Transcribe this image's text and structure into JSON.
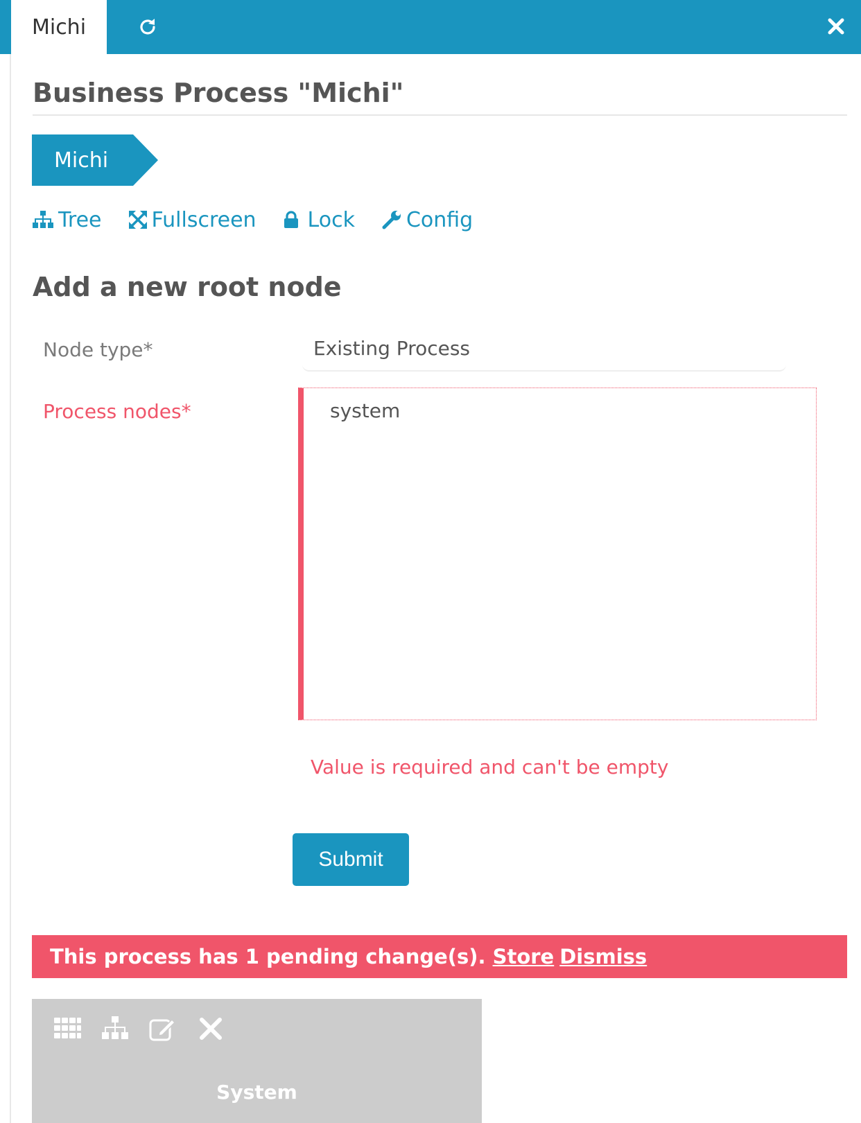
{
  "tabs": [
    {
      "label": "Michi",
      "active": true
    }
  ],
  "header": {
    "refresh_icon": "refresh-icon",
    "close_icon": "close-icon"
  },
  "page": {
    "title": "Business Process \"Michi\""
  },
  "breadcrumb": {
    "items": [
      {
        "label": "Michi"
      }
    ]
  },
  "actions": [
    {
      "label": "Tree",
      "icon": "sitemap-icon"
    },
    {
      "label": "Fullscreen",
      "icon": "fullscreen-icon"
    },
    {
      "label": "Lock",
      "icon": "lock-icon"
    },
    {
      "label": "Config",
      "icon": "wrench-icon"
    }
  ],
  "form": {
    "heading": "Add a new root node",
    "node_type": {
      "label": "Node type*",
      "value": "Existing Process"
    },
    "process_nodes": {
      "label": "Process nodes*",
      "options": [
        "system"
      ],
      "error": "Value is required and can't be empty"
    },
    "submit_label": "Submit"
  },
  "pending": {
    "message": "This process has 1 pending change(s).",
    "store_label": "Store",
    "dismiss_label": "Dismiss"
  },
  "node_tile": {
    "title": "System",
    "icons": [
      "tiles-icon",
      "sitemap-icon",
      "edit-icon",
      "close-icon"
    ]
  },
  "colors": {
    "primary": "#1a95bf",
    "error": "#f0556a",
    "tile": "#cccccc"
  }
}
